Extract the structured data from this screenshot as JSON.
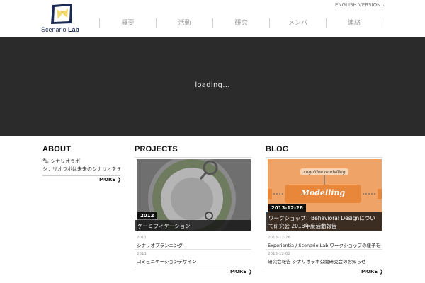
{
  "header": {
    "logo_text_a": "Scenario",
    "logo_text_b": "Lab",
    "lang_label": "ENGLISH VERSION ⌄",
    "nav": [
      "概要",
      "活動",
      "研究",
      "メンバ",
      "連絡"
    ]
  },
  "hero": {
    "loading_text": "loading..."
  },
  "about": {
    "title": "ABOUT",
    "head": "🗞 シナリオラボ",
    "text": "シナリオラボは未来のシナリオをデザインする研究室です",
    "more": "MORE ❯"
  },
  "projects": {
    "title": "PROJECTS",
    "feature_year": "2012",
    "feature_caption": "ゲーミフィケーション",
    "items": [
      {
        "date": "2011",
        "title": "シナリオプランニング"
      },
      {
        "date": "2011",
        "title": "コミュニケーションデザイン"
      }
    ],
    "more": "MORE ❯"
  },
  "blog": {
    "title": "BLOG",
    "feature_date": "2013-12-26",
    "feature_caption": "ワークショップ：Behavioral Designについて研究会 2013年度活動報告",
    "image_label_top": "cognitive modelling",
    "image_label_main": "Modelling",
    "items": [
      {
        "date": "2013-12-26",
        "title": "Experientia / Scenario Lab ワークショップの様子を公開しました"
      },
      {
        "date": "2013-12-02",
        "title": "研究会報告 シナリオラボ公開研究会のお知らせ"
      }
    ],
    "more": "MORE ❯"
  },
  "colors": {
    "hero_bg": "#2b2b2b",
    "logo_navy": "#1a2a55",
    "logo_yellow": "#f2d96b",
    "blog_orange": "#e8863a"
  }
}
